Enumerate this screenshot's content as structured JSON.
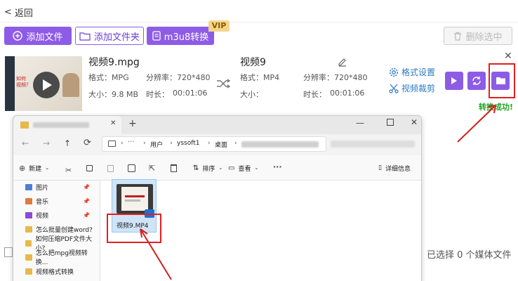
{
  "topbar": {
    "back_label": "返回"
  },
  "toolbar": {
    "add_file": "添加文件",
    "add_folder": "添加文件夹",
    "m3u8": "m3u8转换",
    "vip": "VIP",
    "delete_selected": "删除选中"
  },
  "file": {
    "source_name": "视频9.mpg",
    "source_format_label": "格式：MPG",
    "source_resolution_label": "分辨率：720*480",
    "source_size_label": "大小：9.8 MB",
    "source_duration_label": "时长：",
    "source_duration": "00:01:06",
    "target_name": "视频9",
    "target_format_label": "格式：MP4",
    "target_resolution_label": "分辨率：720*480",
    "target_size_label": "大小：",
    "target_duration_label": "时长：",
    "target_duration": "00:01:06",
    "format_settings": "格式设置",
    "video_crop": "视频裁剪",
    "success": "转换成功!"
  },
  "thumb_text": {
    "line1": "如何",
    "line2": "视频？"
  },
  "explorer": {
    "path": [
      "用户",
      "yssoft1",
      "桌面"
    ],
    "new_label": "新建",
    "sort_label": "排序",
    "view_label": "查看",
    "details_label": "详细信息",
    "sidebar": [
      {
        "label": "图片",
        "icon": "image-icon",
        "color": "#4a7fd6",
        "pinned": true
      },
      {
        "label": "音乐",
        "icon": "music-icon",
        "color": "#e07a3a",
        "pinned": true
      },
      {
        "label": "视频",
        "icon": "video-icon",
        "color": "#8a4ad6",
        "pinned": true
      },
      {
        "label": "怎么批量创建word?",
        "icon": "folder-icon",
        "color": "#e8b84a",
        "pinned": false
      },
      {
        "label": "如何压缩PDF文件大小?",
        "icon": "folder-icon",
        "color": "#e8b84a",
        "pinned": false
      },
      {
        "label": "怎么把mpg视频转换...",
        "icon": "folder-icon",
        "color": "#e8b84a",
        "pinned": false
      },
      {
        "label": "视频格式转换",
        "icon": "folder-icon",
        "color": "#e8b84a",
        "pinned": false
      }
    ],
    "file_name": "视频9.MP4"
  },
  "footer": {
    "selected": "已选择 0 个媒体文件"
  }
}
